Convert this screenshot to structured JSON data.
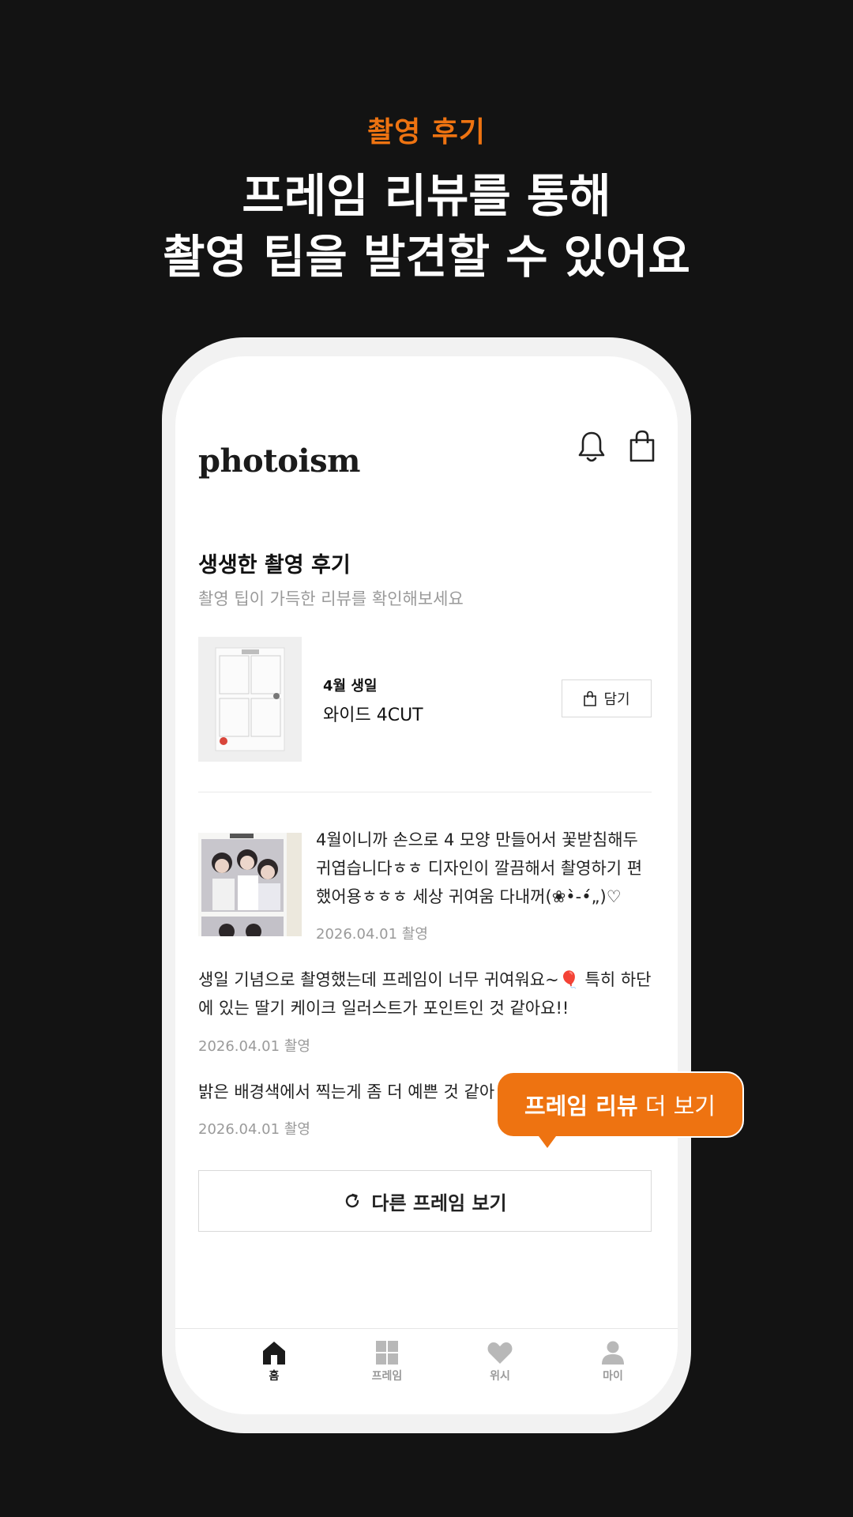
{
  "promo": {
    "eyebrow": "촬영 후기",
    "headline_line1": "프레임 리뷰를 통해",
    "headline_line2": "촬영 팁을 발견할 수 있어요"
  },
  "app": {
    "logo": "photoism",
    "header_icons": [
      "bell-icon",
      "shopping-bag-icon"
    ]
  },
  "section": {
    "title": "생생한 촬영 후기",
    "subtitle": "촬영 팁이 가득한 리뷰를 확인해보세요"
  },
  "frame": {
    "category": "4월 생일",
    "name": "와이드 4CUT",
    "add_label": "담기"
  },
  "reviews": [
    {
      "text": "4월이니까 손으로 4 모양 만들어서 꽃받침해두 귀엽습니다ㅎㅎ 디자인이 깔끔해서 촬영하기 편했어용ㅎㅎㅎ 세상 귀여움 다내꺼(❀•̀-•́„)♡",
      "date": "2026.04.01 촬영"
    },
    {
      "text": "생일 기념으로 촬영했는데 프레임이 너무 귀여워요~🎈 특히 하단에 있는 딸기 케이크 일러스트가 포인트인 것 같아요!!",
      "date": "2026.04.01 촬영"
    },
    {
      "text": "밝은 배경색에서 찍는게 좀 더 예쁜 것 같아",
      "date": "2026.04.01 촬영"
    }
  ],
  "other_frame_button": "다른 프레임 보기",
  "tooltip": {
    "bold": "프레임 리뷰",
    "rest": " 더 보기"
  },
  "tabs": [
    {
      "label": "홈",
      "icon": "home-icon",
      "active": true
    },
    {
      "label": "프레임",
      "icon": "frame-grid-icon",
      "active": false
    },
    {
      "label": "위시",
      "icon": "heart-icon",
      "active": false
    },
    {
      "label": "마이",
      "icon": "person-icon",
      "active": false
    }
  ],
  "colors": {
    "background": "#131313",
    "accent": "#ee7311",
    "phone_frame": "#f2f2f2",
    "text_primary": "#111111",
    "text_secondary": "#9a9a9a",
    "tab_inactive": "#b8b8b8"
  }
}
